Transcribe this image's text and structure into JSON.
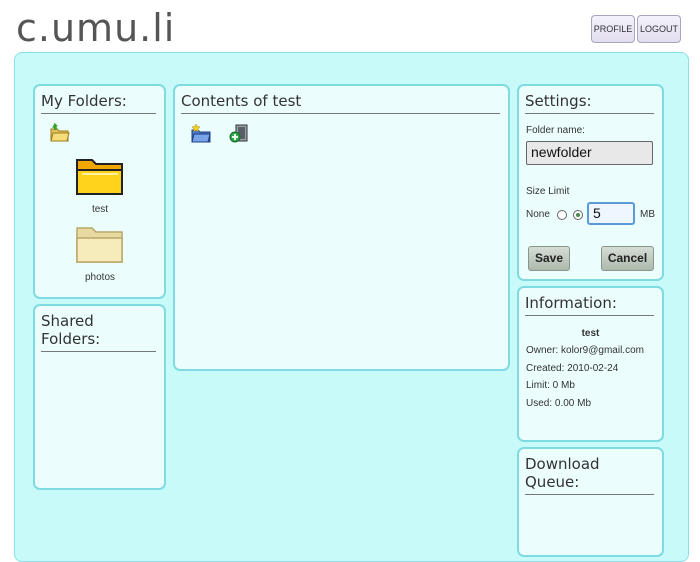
{
  "app": {
    "logo": "c.umu.li"
  },
  "header": {
    "profile_label": "PROFILE",
    "logout_label": "LOGOUT"
  },
  "my_folders": {
    "title": "My Folders:",
    "items": [
      {
        "label": "test",
        "icon": "folder-open-icon"
      },
      {
        "label": "photos",
        "icon": "folder-icon"
      }
    ]
  },
  "shared_folders": {
    "title": "Shared Folders:"
  },
  "contents": {
    "title": "Contents of test"
  },
  "settings": {
    "title": "Settings:",
    "folder_name_label": "Folder name:",
    "folder_name_value": "newfolder",
    "size_limit_label": "Size Limit",
    "none_label": "None",
    "limit_value": "5",
    "unit": "MB",
    "selected": "custom",
    "save_label": "Save",
    "cancel_label": "Cancel"
  },
  "information": {
    "title": "Information:",
    "name": "test",
    "owner": "Owner: kolor9@gmail.com",
    "created": "Created: 2010-02-24",
    "limit": "Limit: 0 Mb",
    "used": "Used: 0.00 Mb"
  },
  "download_queue": {
    "title": "Download Queue:"
  },
  "colors": {
    "panel_border": "#7fdbe2",
    "main_bg": "#c8fafa",
    "panel_bg": "#ecfdfd"
  }
}
